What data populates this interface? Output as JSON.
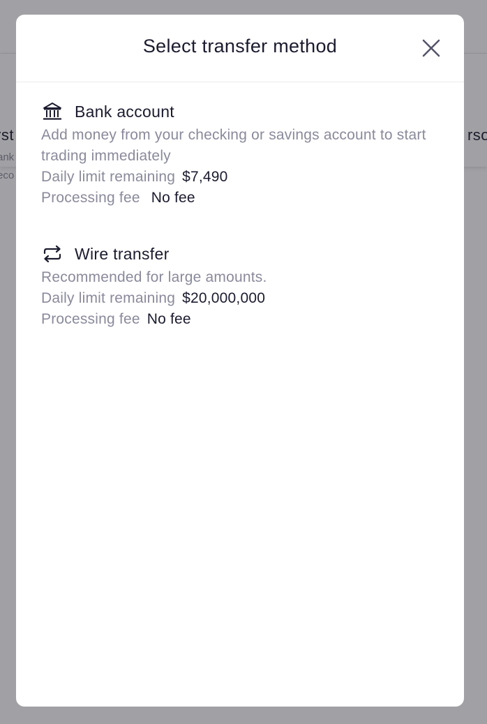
{
  "background": {
    "left_card_title": "rst",
    "left_card_line1": "ank",
    "left_card_line2": "eco",
    "right_card_title": "rso"
  },
  "modal": {
    "title": "Select transfer method",
    "close_icon": "close-icon"
  },
  "methods": [
    {
      "icon": "bank-icon",
      "name": "Bank account",
      "description": "Add money from your checking or savings account to start trading immediately",
      "limit_label": "Daily limit remaining",
      "limit_value": "$7,490",
      "fee_label": "Processing fee",
      "fee_value": "No fee"
    },
    {
      "icon": "transfer-arrows-icon",
      "name": "Wire transfer",
      "description": "Recommended for large amounts.",
      "limit_label": "Daily limit remaining",
      "limit_value": "$20,000,000",
      "fee_label": "Processing fee",
      "fee_value": "No fee"
    }
  ],
  "colors": {
    "text_primary": "#1b1b2f",
    "text_secondary": "#8a8a9c",
    "overlay": "#1e1e28"
  }
}
